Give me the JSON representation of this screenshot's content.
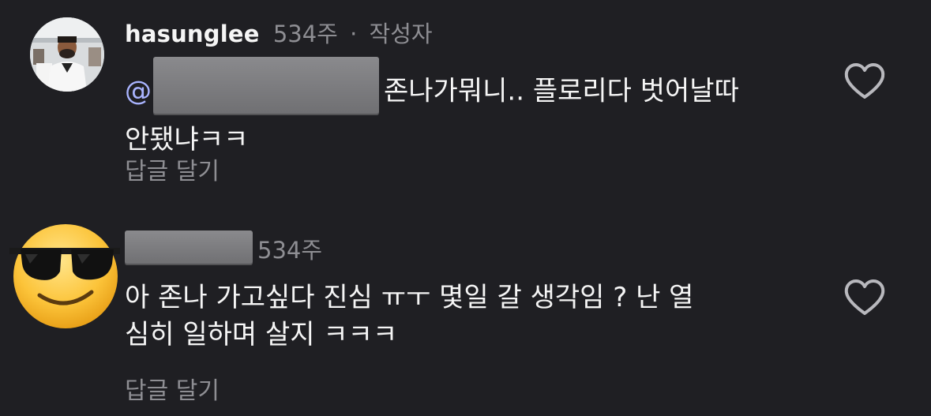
{
  "colors": {
    "background": "#1f1f23",
    "text": "#f5f5f5",
    "muted": "#8e8e93",
    "mention": "#a9b4ff"
  },
  "comments": [
    {
      "username": "hasunglee",
      "time": "534주",
      "author_badge": "작성자",
      "mention_prefix": "@",
      "text_line1": "존나가뭐니.. 플로리다 벗어날따",
      "text_line2": "안됐냐ㅋㅋ",
      "reply_label": "답글 달기",
      "like_icon": "heart-outline-icon",
      "avatar_icon": "profile-photo"
    },
    {
      "time": "534주",
      "text_line1": "아 존나 가고싶다 진심 ㅠㅜ 몇일 갈 생각임 ? 난 열",
      "text_line2": "심히 일하며 살지 ㅋㅋㅋ",
      "reply_label": "답글 달기",
      "like_icon": "heart-outline-icon",
      "avatar_icon": "sunglasses-emoji"
    }
  ]
}
